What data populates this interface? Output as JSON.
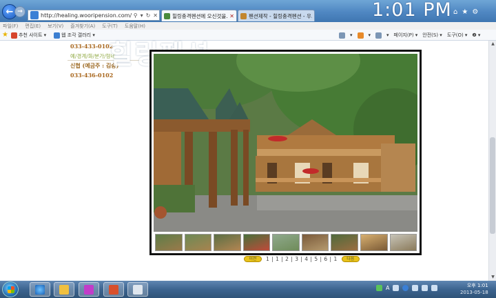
{
  "browser": {
    "address": "http://healing.wooripension.com/",
    "tabs": [
      {
        "label": "힐링충격펜션에 오신것을..."
      },
      {
        "label": "펜션제작 - 힐링충격펜션 - 우..."
      }
    ],
    "clock_overlay": "1:01 PM"
  },
  "menubar": {
    "items": [
      "파일(F)",
      "편집(E)",
      "보기(V)",
      "즐겨찾기(A)",
      "도구(T)",
      "도움말(H)"
    ]
  },
  "favorites": {
    "items": [
      {
        "label": "추천 사이트 ▾",
        "color": "#d6452c"
      },
      {
        "label": "웹 조각 갤러리 ▾",
        "color": "#3c7fd1"
      }
    ]
  },
  "commandbar": {
    "items": [
      {
        "label": "▾"
      },
      {
        "label": "▾"
      },
      {
        "label": "▾"
      },
      {
        "label": "페이지(P) ▾"
      },
      {
        "label": "안전(S) ▾"
      },
      {
        "label": "도구(O) ▾"
      },
      {
        "label": "❷ ▾"
      }
    ]
  },
  "page": {
    "watermark": "힐링펜션",
    "phone_1": "033-433-0102",
    "preference_text": "예/경계/화/분가/형네",
    "sinhyeop": "신협 (예금주 : 김송)",
    "phone_2": "033-436-0102"
  },
  "gallery": {
    "thumbnails": [
      "thumb-1",
      "thumb-2",
      "thumb-3",
      "thumb-4",
      "thumb-5",
      "thumb-6",
      "thumb-7",
      "thumb-8",
      "thumb-9"
    ],
    "pager": {
      "prev_label": "이전",
      "next_label": "다음",
      "numbers": "1 | 1 | 2 | 3 | 4 | 5 | 6 | 1"
    }
  },
  "taskbar": {
    "tray_lang": "A",
    "time": "오후 1:01",
    "date": "2013-05-18"
  },
  "colors": {
    "accent_phone": "#a8661c",
    "pager_button": "#e8c21a",
    "titlebar": "#4f87c2"
  }
}
